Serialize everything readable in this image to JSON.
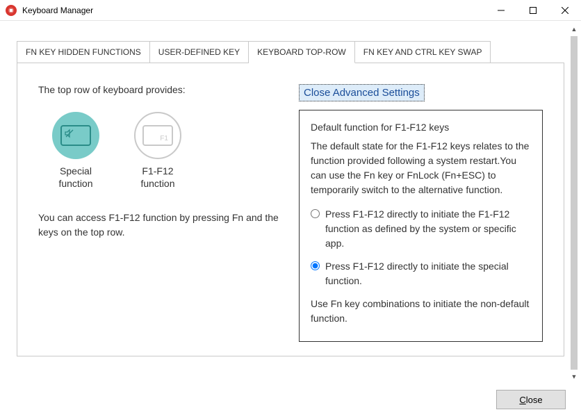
{
  "window": {
    "title": "Keyboard Manager"
  },
  "tabs": {
    "t1": "FN KEY HIDDEN FUNCTIONS",
    "t2": "USER-DEFINED KEY",
    "t3": "KEYBOARD TOP-ROW",
    "t4": "FN KEY AND CTRL KEY SWAP"
  },
  "panel": {
    "intro": "The top row of keyboard provides:",
    "option1_line1": "Special",
    "option1_line2": "function",
    "option2_line1": "F1-F12",
    "option2_line2": "function",
    "option2_keylabel": "F1",
    "note": "You can access F1-F12 function by pressing Fn and the keys on the top row."
  },
  "advanced": {
    "toggle": "Close Advanced Settings",
    "heading": "Default function for F1-F12 keys",
    "desc": "The default state for the F1-F12 keys relates to the function provided following a system restart.You can use the Fn key or FnLock (Fn+ESC) to temporarily switch to the alternative function.",
    "radio1": "Press F1-F12 directly to initiate the F1-F12 function as defined by the system or specific app.",
    "radio2": "Press F1-F12 directly to initiate the special function.",
    "footer_note": "Use Fn key combinations to initiate the non-default function."
  },
  "footer": {
    "close": "Close"
  }
}
